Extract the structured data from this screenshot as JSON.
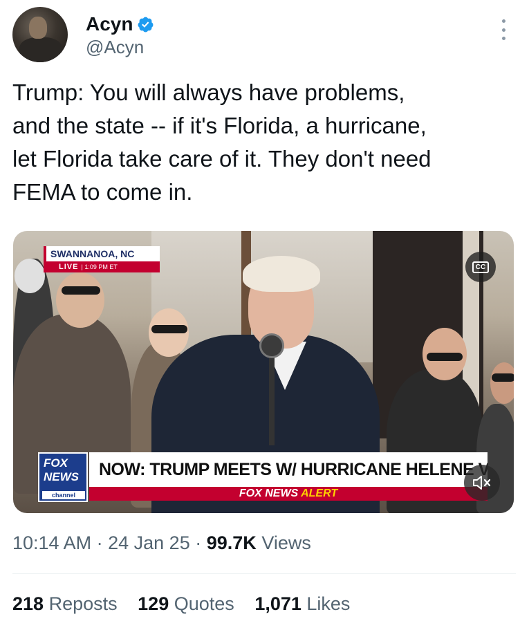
{
  "author": {
    "display_name": "Acyn",
    "handle": "@Acyn",
    "verified": true,
    "verified_color": "#1d9bf0"
  },
  "tweet": {
    "text": "Trump: You will always have problems,\nand the state -- if it's Florida, a hurricane,\nlet Florida take care of it. They don't need\nFEMA to come in."
  },
  "media": {
    "location_label": "SWANNANOA, NC",
    "live_label": "LIVE",
    "live_time": "1:09 PM ET",
    "cc_label": "CC",
    "logo_line1": "FOX",
    "logo_line2": "NEWS",
    "logo_line3": "channel",
    "headline": "NOW: TRUMP MEETS W/ HURRICANE HELENE VICTIMS",
    "alert_prefix": "FOX NEWS",
    "alert_word": "ALERT",
    "brand_red": "#c3002f",
    "brand_blue": "#1c3d8c"
  },
  "meta": {
    "time": "10:14 AM",
    "separator": "·",
    "date": "24 Jan 25",
    "views_count": "99.7K",
    "views_label": "Views"
  },
  "stats": {
    "reposts_count": "218",
    "reposts_label": "Reposts",
    "quotes_count": "129",
    "quotes_label": "Quotes",
    "likes_count": "1,071",
    "likes_label": "Likes"
  }
}
